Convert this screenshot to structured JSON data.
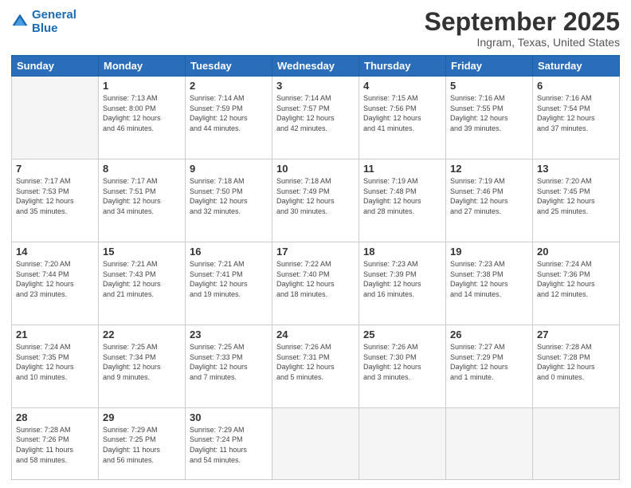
{
  "header": {
    "logo_line1": "General",
    "logo_line2": "Blue",
    "month_title": "September 2025",
    "location": "Ingram, Texas, United States"
  },
  "weekdays": [
    "Sunday",
    "Monday",
    "Tuesday",
    "Wednesday",
    "Thursday",
    "Friday",
    "Saturday"
  ],
  "weeks": [
    [
      {
        "day": "",
        "info": ""
      },
      {
        "day": "1",
        "info": "Sunrise: 7:13 AM\nSunset: 8:00 PM\nDaylight: 12 hours\nand 46 minutes."
      },
      {
        "day": "2",
        "info": "Sunrise: 7:14 AM\nSunset: 7:59 PM\nDaylight: 12 hours\nand 44 minutes."
      },
      {
        "day": "3",
        "info": "Sunrise: 7:14 AM\nSunset: 7:57 PM\nDaylight: 12 hours\nand 42 minutes."
      },
      {
        "day": "4",
        "info": "Sunrise: 7:15 AM\nSunset: 7:56 PM\nDaylight: 12 hours\nand 41 minutes."
      },
      {
        "day": "5",
        "info": "Sunrise: 7:16 AM\nSunset: 7:55 PM\nDaylight: 12 hours\nand 39 minutes."
      },
      {
        "day": "6",
        "info": "Sunrise: 7:16 AM\nSunset: 7:54 PM\nDaylight: 12 hours\nand 37 minutes."
      }
    ],
    [
      {
        "day": "7",
        "info": "Sunrise: 7:17 AM\nSunset: 7:53 PM\nDaylight: 12 hours\nand 35 minutes."
      },
      {
        "day": "8",
        "info": "Sunrise: 7:17 AM\nSunset: 7:51 PM\nDaylight: 12 hours\nand 34 minutes."
      },
      {
        "day": "9",
        "info": "Sunrise: 7:18 AM\nSunset: 7:50 PM\nDaylight: 12 hours\nand 32 minutes."
      },
      {
        "day": "10",
        "info": "Sunrise: 7:18 AM\nSunset: 7:49 PM\nDaylight: 12 hours\nand 30 minutes."
      },
      {
        "day": "11",
        "info": "Sunrise: 7:19 AM\nSunset: 7:48 PM\nDaylight: 12 hours\nand 28 minutes."
      },
      {
        "day": "12",
        "info": "Sunrise: 7:19 AM\nSunset: 7:46 PM\nDaylight: 12 hours\nand 27 minutes."
      },
      {
        "day": "13",
        "info": "Sunrise: 7:20 AM\nSunset: 7:45 PM\nDaylight: 12 hours\nand 25 minutes."
      }
    ],
    [
      {
        "day": "14",
        "info": "Sunrise: 7:20 AM\nSunset: 7:44 PM\nDaylight: 12 hours\nand 23 minutes."
      },
      {
        "day": "15",
        "info": "Sunrise: 7:21 AM\nSunset: 7:43 PM\nDaylight: 12 hours\nand 21 minutes."
      },
      {
        "day": "16",
        "info": "Sunrise: 7:21 AM\nSunset: 7:41 PM\nDaylight: 12 hours\nand 19 minutes."
      },
      {
        "day": "17",
        "info": "Sunrise: 7:22 AM\nSunset: 7:40 PM\nDaylight: 12 hours\nand 18 minutes."
      },
      {
        "day": "18",
        "info": "Sunrise: 7:23 AM\nSunset: 7:39 PM\nDaylight: 12 hours\nand 16 minutes."
      },
      {
        "day": "19",
        "info": "Sunrise: 7:23 AM\nSunset: 7:38 PM\nDaylight: 12 hours\nand 14 minutes."
      },
      {
        "day": "20",
        "info": "Sunrise: 7:24 AM\nSunset: 7:36 PM\nDaylight: 12 hours\nand 12 minutes."
      }
    ],
    [
      {
        "day": "21",
        "info": "Sunrise: 7:24 AM\nSunset: 7:35 PM\nDaylight: 12 hours\nand 10 minutes."
      },
      {
        "day": "22",
        "info": "Sunrise: 7:25 AM\nSunset: 7:34 PM\nDaylight: 12 hours\nand 9 minutes."
      },
      {
        "day": "23",
        "info": "Sunrise: 7:25 AM\nSunset: 7:33 PM\nDaylight: 12 hours\nand 7 minutes."
      },
      {
        "day": "24",
        "info": "Sunrise: 7:26 AM\nSunset: 7:31 PM\nDaylight: 12 hours\nand 5 minutes."
      },
      {
        "day": "25",
        "info": "Sunrise: 7:26 AM\nSunset: 7:30 PM\nDaylight: 12 hours\nand 3 minutes."
      },
      {
        "day": "26",
        "info": "Sunrise: 7:27 AM\nSunset: 7:29 PM\nDaylight: 12 hours\nand 1 minute."
      },
      {
        "day": "27",
        "info": "Sunrise: 7:28 AM\nSunset: 7:28 PM\nDaylight: 12 hours\nand 0 minutes."
      }
    ],
    [
      {
        "day": "28",
        "info": "Sunrise: 7:28 AM\nSunset: 7:26 PM\nDaylight: 11 hours\nand 58 minutes."
      },
      {
        "day": "29",
        "info": "Sunrise: 7:29 AM\nSunset: 7:25 PM\nDaylight: 11 hours\nand 56 minutes."
      },
      {
        "day": "30",
        "info": "Sunrise: 7:29 AM\nSunset: 7:24 PM\nDaylight: 11 hours\nand 54 minutes."
      },
      {
        "day": "",
        "info": ""
      },
      {
        "day": "",
        "info": ""
      },
      {
        "day": "",
        "info": ""
      },
      {
        "day": "",
        "info": ""
      }
    ]
  ]
}
